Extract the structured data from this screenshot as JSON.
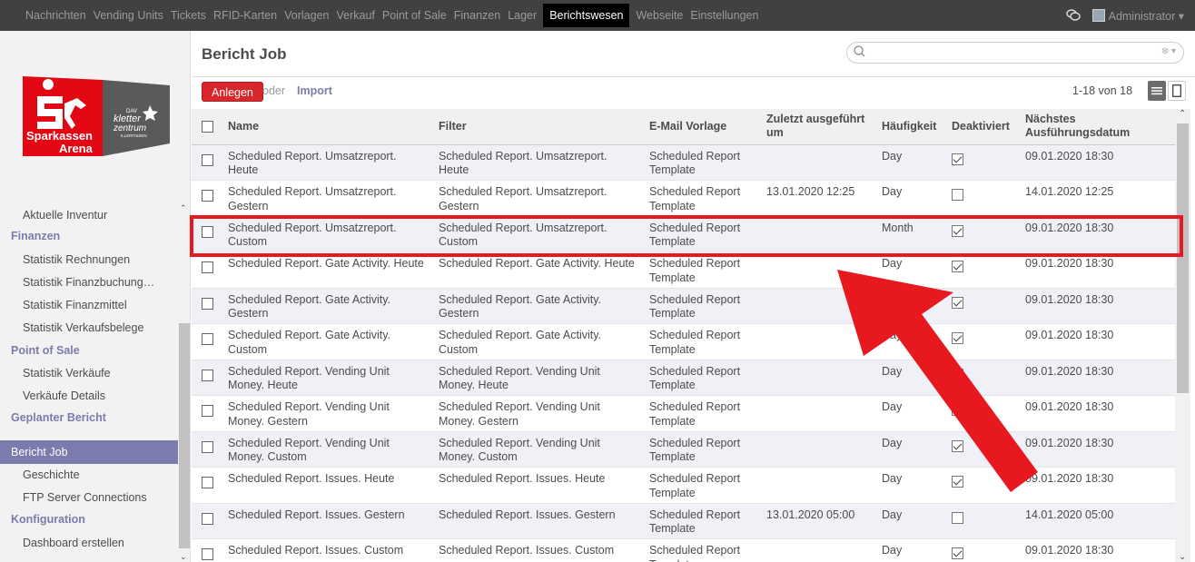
{
  "topnav": {
    "items": [
      "Nachrichten",
      "Vending Units",
      "Tickets",
      "RFID-Karten",
      "Vorlagen",
      "Verkauf",
      "Point of Sale",
      "Finanzen",
      "Lager",
      "Berichtswesen",
      "Webseite",
      "Einstellungen"
    ],
    "active": "Berichtswesen",
    "user": "Administrator ▾"
  },
  "logo": {
    "line1": "Sparkassen",
    "line2": "Arena",
    "small": "DAV",
    "k1": "kletter",
    "k2": "zentrum",
    "k3": "ILLERTISSEN"
  },
  "sidebar": {
    "items": [
      {
        "type": "item",
        "label": "Aktuelle Inventur"
      },
      {
        "type": "head",
        "label": "Finanzen"
      },
      {
        "type": "item",
        "label": "Statistik Rechnungen"
      },
      {
        "type": "item",
        "label": "Statistik Finanzbuchung…"
      },
      {
        "type": "item",
        "label": "Statistik Finanzmittel"
      },
      {
        "type": "item",
        "label": "Statistik Verkaufsbelege"
      },
      {
        "type": "head",
        "label": "Point of Sale"
      },
      {
        "type": "item",
        "label": "Statistik Verkäufe"
      },
      {
        "type": "item",
        "label": "Verkäufe Details"
      },
      {
        "type": "head",
        "label": "Geplanter Bericht"
      },
      {
        "type": "item",
        "label": "Bericht Job",
        "active": true
      },
      {
        "type": "item",
        "label": "Geschichte"
      },
      {
        "type": "item",
        "label": "FTP Server Connections"
      },
      {
        "type": "head",
        "label": "Konfiguration"
      },
      {
        "type": "item",
        "label": "Dashboard erstellen"
      }
    ]
  },
  "header": {
    "title": "Bericht Job",
    "create_label": "Anlegen",
    "or_label": "oder",
    "import_label": "Import",
    "pager": "1-18 von 18"
  },
  "table": {
    "columns": [
      "Name",
      "Filter",
      "E-Mail Vorlage",
      "Zuletzt ausgeführt um",
      "Häufigkeit",
      "Deaktiviert",
      "Nächstes Ausführungsdatum"
    ],
    "rows": [
      {
        "name": "Scheduled Report. Umsatzreport. Heute",
        "filter": "Scheduled Report. Umsatzreport. Heute",
        "template": "Scheduled Report Template",
        "last": "",
        "freq": "Day",
        "disabled": true,
        "next": "09.01.2020 18:30"
      },
      {
        "name": "Scheduled Report. Umsatzreport. Gestern",
        "filter": "Scheduled Report. Umsatzreport. Gestern",
        "template": "Scheduled Report Template",
        "last": "13.01.2020 12:25",
        "freq": "Day",
        "disabled": false,
        "next": "14.01.2020 12:25"
      },
      {
        "name": "Scheduled Report. Umsatzreport. Custom",
        "filter": "Scheduled Report. Umsatzreport. Custom",
        "template": "Scheduled Report Template",
        "last": "",
        "freq": "Month",
        "disabled": true,
        "next": "09.01.2020 18:30"
      },
      {
        "name": "Scheduled Report. Gate Activity. Heute",
        "filter": "Scheduled Report. Gate Activity. Heute",
        "template": "Scheduled Report Template",
        "last": "",
        "freq": "Day",
        "disabled": true,
        "next": "09.01.2020 18:30"
      },
      {
        "name": "Scheduled Report. Gate Activity. Gestern",
        "filter": "Scheduled Report. Gate Activity. Gestern",
        "template": "Scheduled Report Template",
        "last": "",
        "freq": "Day",
        "disabled": true,
        "next": "09.01.2020 18:30"
      },
      {
        "name": "Scheduled Report. Gate Activity. Custom",
        "filter": "Scheduled Report. Gate Activity. Custom",
        "template": "Scheduled Report Template",
        "last": "",
        "freq": "Day",
        "disabled": true,
        "next": "09.01.2020 18:30"
      },
      {
        "name": "Scheduled Report. Vending Unit Money. Heute",
        "filter": "Scheduled Report. Vending Unit Money. Heute",
        "template": "Scheduled Report Template",
        "last": "",
        "freq": "Day",
        "disabled": true,
        "next": "09.01.2020 18:30"
      },
      {
        "name": "Scheduled Report. Vending Unit Money. Gestern",
        "filter": "Scheduled Report. Vending Unit Money. Gestern",
        "template": "Scheduled Report Template",
        "last": "",
        "freq": "Day",
        "disabled": true,
        "next": "09.01.2020 18:30"
      },
      {
        "name": "Scheduled Report. Vending Unit Money. Custom",
        "filter": "Scheduled Report. Vending Unit Money. Custom",
        "template": "Scheduled Report Template",
        "last": "",
        "freq": "Day",
        "disabled": true,
        "next": "09.01.2020 18:30"
      },
      {
        "name": "Scheduled Report. Issues. Heute",
        "filter": "Scheduled Report. Issues. Heute",
        "template": "Scheduled Report Template",
        "last": "",
        "freq": "Day",
        "disabled": true,
        "next": "09.01.2020 18:30"
      },
      {
        "name": "Scheduled Report. Issues. Gestern",
        "filter": "Scheduled Report. Issues. Gestern",
        "template": "Scheduled Report Template",
        "last": "13.01.2020 05:00",
        "freq": "Day",
        "disabled": false,
        "next": "14.01.2020 05:00"
      },
      {
        "name": "Scheduled Report. Issues. Custom",
        "filter": "Scheduled Report. Issues. Custom",
        "template": "Scheduled Report Template",
        "last": "",
        "freq": "Day",
        "disabled": true,
        "next": "09.01.2020 18:30"
      }
    ]
  },
  "colors": {
    "accent": "#7c7bad",
    "create_button": "#d9262b",
    "annotation": "#e8191e"
  },
  "icons": {
    "chat": "chat-icon",
    "search": "search-icon",
    "list_view": "list-view-icon",
    "form_view": "form-view-icon"
  }
}
